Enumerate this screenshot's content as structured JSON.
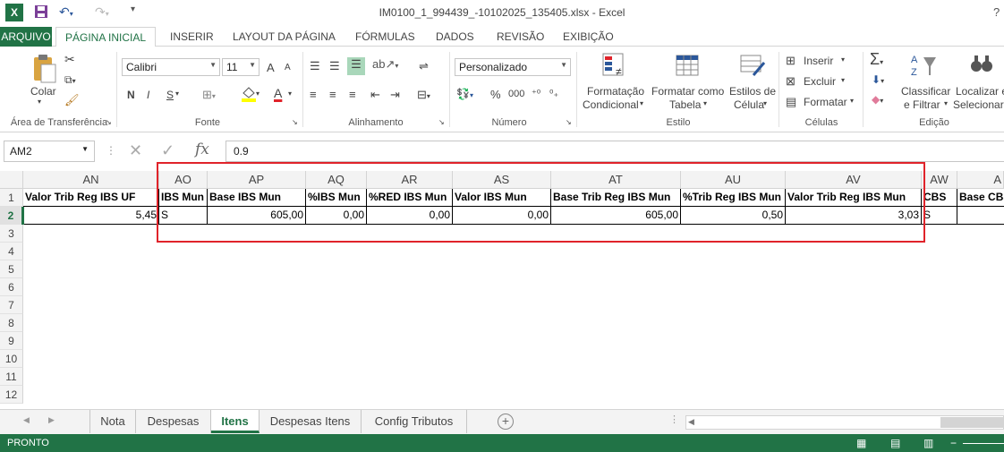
{
  "window": {
    "title": "IM0100_1_994439_-10102025_135405.xlsx - Excel",
    "help": "?"
  },
  "ribbon_tabs": [
    "ARQUIVO",
    "PÁGINA INICIAL",
    "INSERIR",
    "LAYOUT DA PÁGINA",
    "FÓRMULAS",
    "DADOS",
    "REVISÃO",
    "EXIBIÇÃO"
  ],
  "ribbon": {
    "clipboard": {
      "paste": "Colar",
      "label": "Área de Transferência"
    },
    "font": {
      "name": "Calibri",
      "size": "11",
      "bold": "N",
      "italic": "I",
      "underline": "S",
      "label": "Fonte",
      "grow": "A",
      "shrink": "A",
      "color_letter": "A"
    },
    "alignment": {
      "label": "Alinhamento"
    },
    "number": {
      "format": "Personalizado",
      "percent": "%",
      "thousands": "000",
      "label": "Número"
    },
    "styles": {
      "cond1": "Formatação",
      "cond2": "Condicional",
      "table1": "Formatar como",
      "table2": "Tabela",
      "cell1": "Estilos de",
      "cell2": "Célula",
      "label": "Estilo"
    },
    "cells": {
      "insert": "Inserir",
      "delete": "Excluir",
      "format": "Formatar",
      "label": "Células"
    },
    "editing": {
      "sort1": "Classificar",
      "sort2": "e Filtrar",
      "find1": "Localizar e",
      "find2": "Selecionar",
      "label": "Edição"
    }
  },
  "formula_bar": {
    "name_box": "AM2",
    "fx": "fx",
    "value": "0.9"
  },
  "columns": [
    "AN",
    "AO",
    "AP",
    "AQ",
    "AR",
    "AS",
    "AT",
    "AU",
    "AV",
    "AW",
    "A"
  ],
  "rows": [
    "1",
    "2",
    "3",
    "4",
    "5",
    "6",
    "7",
    "8",
    "9",
    "10",
    "11",
    "12"
  ],
  "row1": [
    "Valor Trib Reg IBS UF",
    "IBS Mun",
    "Base IBS Mun",
    "%IBS Mun",
    "%RED IBS Mun",
    "Valor IBS Mun",
    "Base Trib Reg IBS Mun",
    "%Trib Reg IBS Mun",
    "Valor Trib Reg IBS Mun",
    "CBS",
    "Base CBS"
  ],
  "row2": [
    "5,45",
    "S",
    "605,00",
    "0,00",
    "0,00",
    "0,00",
    "605,00",
    "0,50",
    "3,03",
    "S",
    ""
  ],
  "sheet_tabs": [
    "Nota",
    "Despesas",
    "Itens",
    "Despesas Itens",
    "Config Tributos"
  ],
  "active_sheet": "Itens",
  "status": "PRONTO",
  "accent_color": "#217346",
  "highlight_color": "#e0232a"
}
